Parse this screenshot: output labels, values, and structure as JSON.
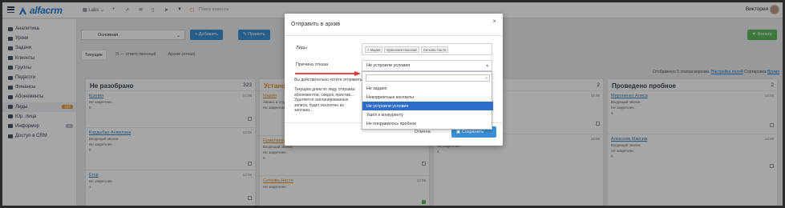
{
  "app": {
    "brand": "alfacrm",
    "user_name": "Виктория"
  },
  "topbar": {
    "labs": "Labs",
    "search_placeholder": "Поиск клиента"
  },
  "sidebar": {
    "items": [
      {
        "label": "Аналитика",
        "badge": ""
      },
      {
        "label": "Уроки",
        "badge": ""
      },
      {
        "label": "Задачи",
        "badge": ""
      },
      {
        "label": "Клиенты",
        "badge": ""
      },
      {
        "label": "Группы",
        "badge": ""
      },
      {
        "label": "Педагоги",
        "badge": ""
      },
      {
        "label": "Финансы",
        "badge": ""
      },
      {
        "label": "Абонементы",
        "badge": ""
      },
      {
        "label": "Лиды",
        "badge": "127"
      },
      {
        "label": "Юр. лица",
        "badge": ""
      },
      {
        "label": "Информер",
        "badge": "0"
      },
      {
        "label": "Доступ в CRM",
        "badge": ""
      }
    ]
  },
  "filters": {
    "select_value": "Основная",
    "add_button": "+ Добавить",
    "edit_button": "✎ Править",
    "right_button": "▼ Фильтр"
  },
  "tabs": [
    "Текущие",
    "Я — ответственный",
    "Архив (отказ)"
  ],
  "status_line": {
    "text": "Отображено 5 этапов воронки.",
    "link": "Настройка полей",
    "sort_label": "Сортировка",
    "sort_value": "Время"
  },
  "board": {
    "columns": [
      {
        "title": "Не разобрано",
        "count": "323",
        "cards": [
          {
            "name": "Ксения",
            "date": "14:06",
            "line1": "Не закреплен",
            "line2": "0",
            "orange": false,
            "green": false
          },
          {
            "name": "Кордыбан Анжелика",
            "date": "14:05",
            "line1": "Входящий звонок",
            "line2": "Не закреплен",
            "line3": "0",
            "orange": false,
            "green": false
          },
          {
            "name": "Егор",
            "date": "14:05",
            "line1": "Не закреплен",
            "line2": "1",
            "orange": false,
            "green": false
          }
        ]
      },
      {
        "title": "Установлен",
        "count": "",
        "cards": [
          {
            "name": "Мария",
            "date": "14:06",
            "line1": "Запись в студию",
            "line2": "Не закреплен",
            "line3": "0",
            "orange": true,
            "green": true
          },
          {
            "name": "Ермолаев",
            "date": "",
            "line1": "Входящий звонок",
            "line2": "Не закреплен",
            "line3": "0",
            "orange": true,
            "green": false
          },
          {
            "name": "Сеткова Настя",
            "date": "14:05",
            "line1": "Не закреплен",
            "line2": "",
            "orange": true,
            "green": true
          }
        ]
      },
      {
        "title": "",
        "count": "2",
        "cards": [
          {
            "name": "",
            "date": "14:06",
            "line1": "",
            "line2": "",
            "orange": false,
            "green": false
          },
          {
            "name": "",
            "date": "14:05",
            "line1": "Рекомендация",
            "line2": "Не закреплен",
            "line3": "1",
            "orange": false,
            "green": false
          }
        ]
      },
      {
        "title": "Проведено пробное",
        "count": "2",
        "cards": [
          {
            "name": "Мироненко Алиса",
            "date": "14:06",
            "line1": "Входящий звонок",
            "line2": "Не закреплен",
            "line3": "1",
            "orange": false,
            "green": false
          },
          {
            "name": "Алексеев Максим",
            "date": "14:05",
            "line1": "Входящий звонок",
            "line2": "Не закреплен",
            "line3": "0",
            "orange": false,
            "green": false
          }
        ]
      }
    ]
  },
  "modal": {
    "title": "Отправить в архив",
    "leads_label": "Лиды",
    "lead_chips": [
      "× Мария",
      "Ермолаев Николай",
      "Сеткова Настя"
    ],
    "reason_label": "Причина отказа",
    "reason_value": "Не устроили условия",
    "question": "Вы действительно хотите отправить",
    "warning": "Текущим днем по лиду отправка абонементов, скидок, пристав... Удаляется запланированные записи, будет исключен из заплани...",
    "cancel": "Отмена",
    "save": "Сохранить"
  },
  "dropdown": {
    "options": [
      "Не задано",
      "Некорректные контакты",
      "Не устроили условия",
      "Ушёл к конкуренту",
      "Не понравилось пробное"
    ],
    "selected_index": 2
  },
  "colors": {
    "accent": "#3c8fd3",
    "brand": "#1e7fd6",
    "selected": "#2e6ecb",
    "arrow": "#e03131"
  }
}
